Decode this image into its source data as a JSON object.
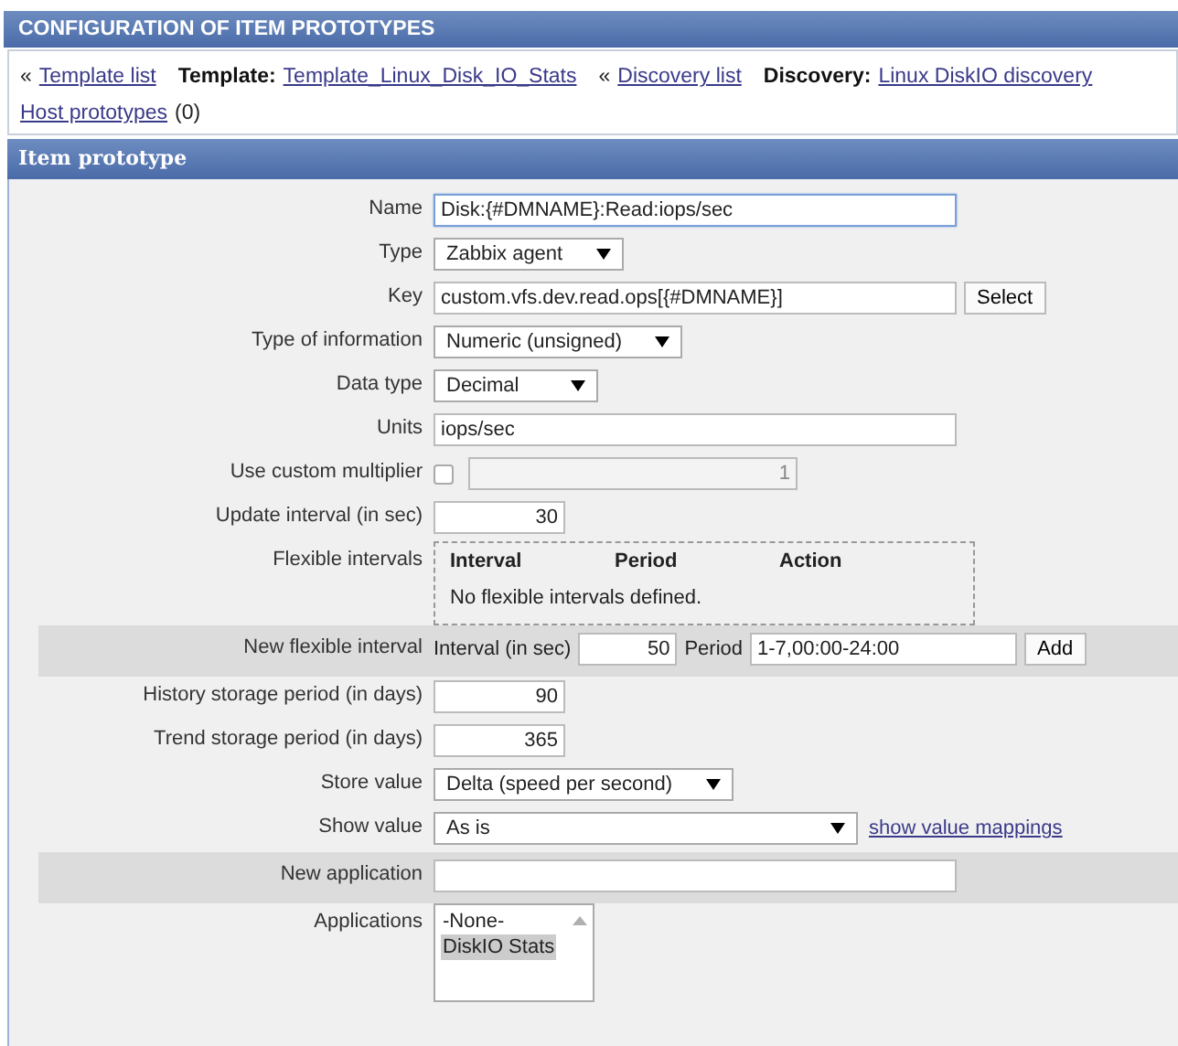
{
  "header": {
    "title": "CONFIGURATION OF ITEM PROTOTYPES"
  },
  "breadcrumbs": [
    {
      "kind": "link",
      "prefix": "«",
      "text": "Template list"
    },
    {
      "kind": "labelled",
      "label": "Template:",
      "text": "Template_Linux_Disk_IO_Stats"
    },
    {
      "kind": "link",
      "prefix": "«",
      "text": "Discovery list"
    },
    {
      "kind": "labelled",
      "label": "Discovery:",
      "text": "Linux DiskIO discovery"
    },
    {
      "kind": "count",
      "text": "Host prototypes",
      "count": "(0)"
    }
  ],
  "form": {
    "title": "Item prototype",
    "rows": [
      {
        "kind": "text",
        "label": "Name",
        "value": "Disk:{#DMNAME}:Read:iops/sec",
        "focused": true,
        "highlight": false
      },
      {
        "kind": "select",
        "label": "Type",
        "value": "Zabbix agent",
        "highlight": false
      },
      {
        "kind": "key",
        "label": "Key",
        "value": "custom.vfs.dev.read.ops[{#DMNAME}]",
        "button": "Select",
        "highlight": false
      },
      {
        "kind": "select",
        "label": "Type of information",
        "value": "Numeric (unsigned)",
        "highlight": false
      },
      {
        "kind": "select",
        "label": "Data type",
        "value": "Decimal",
        "highlight": false
      },
      {
        "kind": "text",
        "label": "Units",
        "value": "iops/sec",
        "focused": false,
        "highlight": false
      },
      {
        "kind": "multiplier",
        "label": "Use custom multiplier",
        "checked": false,
        "value": "1",
        "highlight": false
      },
      {
        "kind": "number",
        "label": "Update interval (in sec)",
        "value": "30",
        "highlight": false
      },
      {
        "kind": "intervals",
        "label": "Flexible intervals",
        "columns": [
          "Interval",
          "Period",
          "Action"
        ],
        "empty": "No flexible intervals defined.",
        "highlight": false
      },
      {
        "kind": "newinterval",
        "label": "New flexible interval",
        "interval_label": "Interval (in sec)",
        "interval": "50",
        "period_label": "Period",
        "period": "1-7,00:00-24:00",
        "button": "Add",
        "highlight": true
      },
      {
        "kind": "number",
        "label": "History storage period (in days)",
        "value": "90",
        "highlight": false
      },
      {
        "kind": "number",
        "label": "Trend storage period (in days)",
        "value": "365",
        "highlight": false
      },
      {
        "kind": "select",
        "label": "Store value",
        "value": "Delta (speed per second)",
        "highlight": false
      },
      {
        "kind": "selectlink",
        "label": "Show value",
        "value": "As is",
        "link": "show value mappings",
        "highlight": false
      },
      {
        "kind": "text",
        "label": "New application",
        "value": "",
        "focused": false,
        "highlight": true
      },
      {
        "kind": "listbox",
        "label": "Applications",
        "options": [
          {
            "text": "-None-",
            "selected": false
          },
          {
            "text": "DiskIO Stats",
            "selected": true
          }
        ],
        "highlight": false
      }
    ]
  }
}
